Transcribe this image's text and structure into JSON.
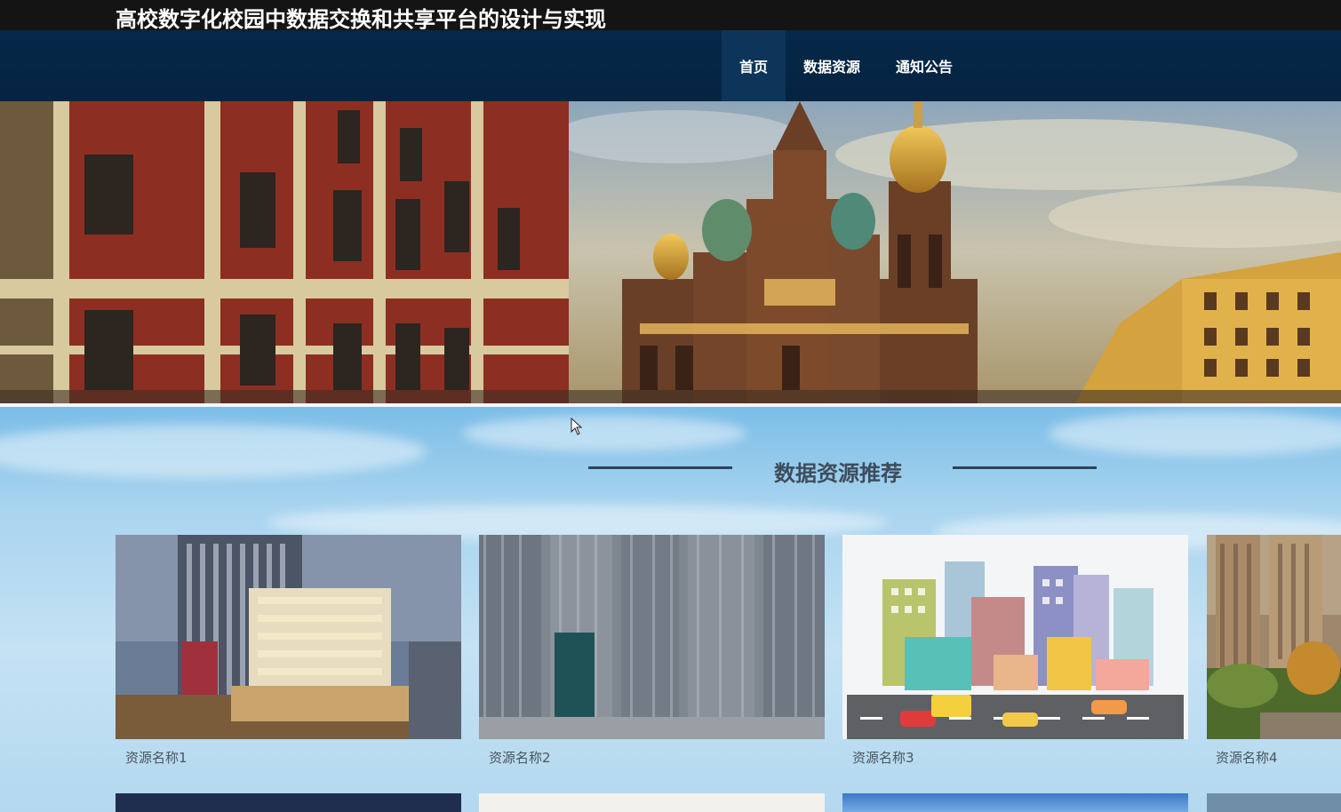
{
  "header": {
    "site_title": "高校数字化校园中数据交换和共享平台的设计与实现"
  },
  "nav": {
    "items": [
      {
        "label": "首页",
        "active": true
      },
      {
        "label": "数据资源",
        "active": false
      },
      {
        "label": "通知公告",
        "active": false
      }
    ]
  },
  "section": {
    "heading": "数据资源推荐"
  },
  "resources": [
    {
      "name": "资源名称1"
    },
    {
      "name": "资源名称2"
    },
    {
      "name": "资源名称3"
    },
    {
      "name": "资源名称4"
    }
  ],
  "colors": {
    "topbar": "#141414",
    "navbar": "#062748",
    "nav_active": "#0d3559",
    "heading_text": "#3d4d5c"
  }
}
